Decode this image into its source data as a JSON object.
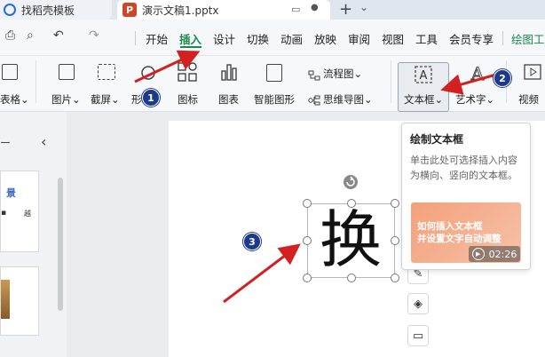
{
  "tabs": [
    {
      "label": "找稻壳模板"
    },
    {
      "label": "演示文稿1.pptx"
    }
  ],
  "tab_controls": {
    "add": "+",
    "chevron": "⌄"
  },
  "quick_access": {
    "print": "⎙",
    "preview": "⌕",
    "undo": "↶",
    "redo": "↷"
  },
  "menu": {
    "items": [
      "开始",
      "插入",
      "设计",
      "切换",
      "动画",
      "放映",
      "审阅",
      "视图",
      "工具",
      "会员专享",
      "绘图工"
    ],
    "active": "插入"
  },
  "ribbon": {
    "table": "表格",
    "image": "图片",
    "screenshot": "截屏",
    "shape": "形",
    "icon": "图标",
    "chart": "图表",
    "smartart": "智能图形",
    "flowchart": "流程图",
    "mindmap": "思维导图",
    "textbox": "文本框",
    "wordart": "艺术字",
    "video": "视频",
    "dropdown": "⌄"
  },
  "left_panel": {
    "collapse": "‹",
    "thumb_text": "景",
    "thumb_sub": "越"
  },
  "slide": {
    "text": "换"
  },
  "tooltip": {
    "title": "绘制文本框",
    "description": "单击此处可选择插入内容为横向、竖向的文本框。",
    "video_text": "如何插入文本框\n并设置文字自动调整",
    "duration": "02:26"
  },
  "badges": [
    "1",
    "2",
    "3"
  ],
  "colors": {
    "accent": "#1a8a4a",
    "arrow": "#d32020",
    "badge": "#1d3a8a"
  }
}
